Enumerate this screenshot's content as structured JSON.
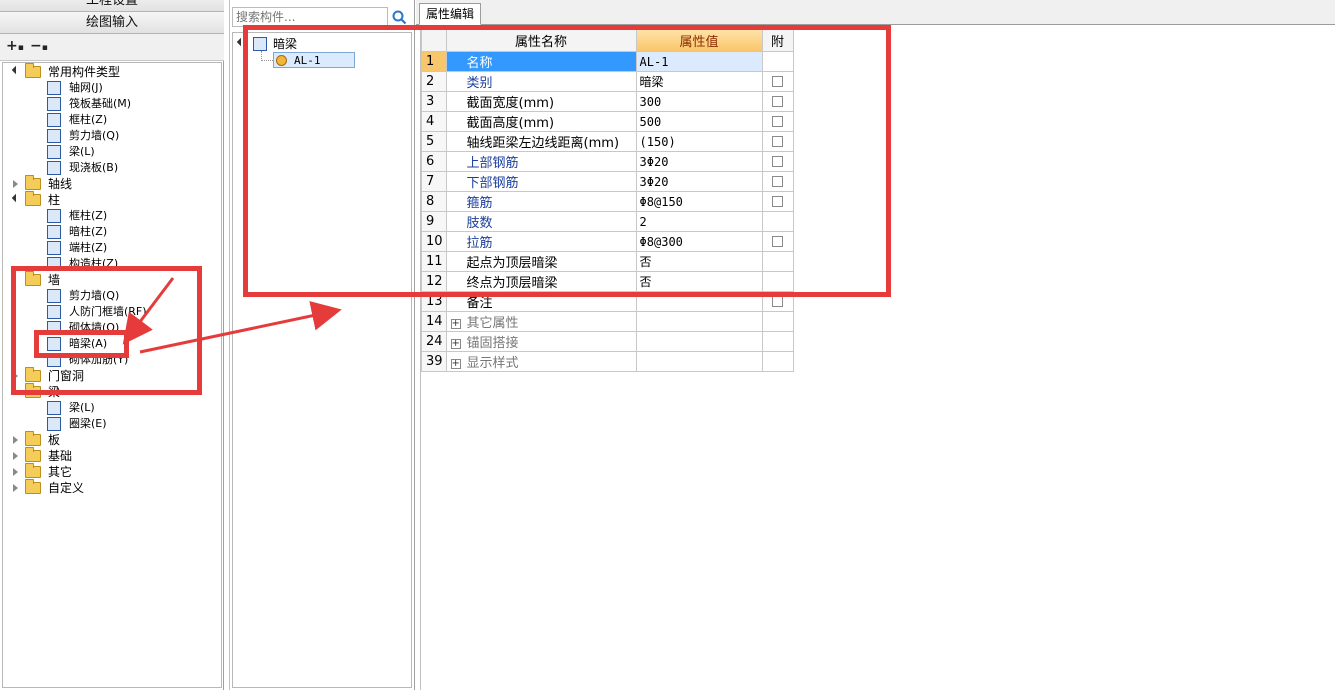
{
  "left_panel": {
    "header_project": "工程设置",
    "header_drawing": "绘图输入",
    "tree": [
      {
        "label": "常用构件类型",
        "type": "folder",
        "level": 0,
        "expanded": true
      },
      {
        "label": "轴网(J)",
        "type": "item",
        "level": 1,
        "icon": "grid-icon"
      },
      {
        "label": "筏板基础(M)",
        "type": "item",
        "level": 1,
        "icon": "raft-icon"
      },
      {
        "label": "框柱(Z)",
        "type": "item",
        "level": 1,
        "icon": "column-icon"
      },
      {
        "label": "剪力墙(Q)",
        "type": "item",
        "level": 1,
        "icon": "wall-icon"
      },
      {
        "label": "梁(L)",
        "type": "item",
        "level": 1,
        "icon": "beam-icon"
      },
      {
        "label": "现浇板(B)",
        "type": "item",
        "level": 1,
        "icon": "slab-icon"
      },
      {
        "label": "轴线",
        "type": "folder",
        "level": 0,
        "expanded": false
      },
      {
        "label": "柱",
        "type": "folder",
        "level": 0,
        "expanded": true
      },
      {
        "label": "框柱(Z)",
        "type": "item",
        "level": 1,
        "icon": "column-icon"
      },
      {
        "label": "暗柱(Z)",
        "type": "item",
        "level": 1,
        "icon": "column-icon"
      },
      {
        "label": "端柱(Z)",
        "type": "item",
        "level": 1,
        "icon": "column-icon"
      },
      {
        "label": "构造柱(Z)",
        "type": "item",
        "level": 1,
        "icon": "column-icon"
      },
      {
        "label": "墙",
        "type": "folder",
        "level": 0,
        "expanded": true
      },
      {
        "label": "剪力墙(Q)",
        "type": "item",
        "level": 1,
        "icon": "wall-icon"
      },
      {
        "label": "人防门框墙(RF)",
        "type": "item",
        "level": 1,
        "icon": "door-frame-icon"
      },
      {
        "label": "砌体墙(Q)",
        "type": "item",
        "level": 1,
        "icon": "masonry-icon"
      },
      {
        "label": "暗梁(A)",
        "type": "item",
        "level": 1,
        "icon": "hidden-beam-icon",
        "selected": true
      },
      {
        "label": "砌体加筋(Y)",
        "type": "item",
        "level": 1,
        "icon": "rebar-icon"
      },
      {
        "label": "门窗洞",
        "type": "folder",
        "level": 0,
        "expanded": false
      },
      {
        "label": "梁",
        "type": "folder",
        "level": 0,
        "expanded": true
      },
      {
        "label": "梁(L)",
        "type": "item",
        "level": 1,
        "icon": "beam-icon"
      },
      {
        "label": "圈梁(E)",
        "type": "item",
        "level": 1,
        "icon": "ring-beam-icon"
      },
      {
        "label": "板",
        "type": "folder",
        "level": 0,
        "expanded": false
      },
      {
        "label": "基础",
        "type": "folder",
        "level": 0,
        "expanded": false
      },
      {
        "label": "其它",
        "type": "folder",
        "level": 0,
        "expanded": false
      },
      {
        "label": "自定义",
        "type": "folder",
        "level": 0,
        "expanded": false
      }
    ]
  },
  "middle_panel": {
    "search_placeholder": "搜索构件...",
    "tree_root": "暗梁",
    "tree_child": "AL-1"
  },
  "right_panel": {
    "tab_label": "属性编辑",
    "columns": {
      "name": "属性名称",
      "value": "属性值",
      "attach": "附"
    },
    "rows": [
      {
        "num": "1",
        "name": "名称",
        "value": "AL-1",
        "color": "blue",
        "check": false,
        "selected": true
      },
      {
        "num": "2",
        "name": "类别",
        "value": "暗梁",
        "color": "blue",
        "check": true
      },
      {
        "num": "3",
        "name": "截面宽度(mm)",
        "value": "300",
        "color": "black",
        "check": true
      },
      {
        "num": "4",
        "name": "截面高度(mm)",
        "value": "500",
        "color": "black",
        "check": true
      },
      {
        "num": "5",
        "name": "轴线距梁左边线距离(mm)",
        "value": "(150)",
        "color": "black",
        "check": true
      },
      {
        "num": "6",
        "name": "上部钢筋",
        "value": "3Φ20",
        "color": "blue",
        "check": true
      },
      {
        "num": "7",
        "name": "下部钢筋",
        "value": "3Φ20",
        "color": "blue",
        "check": true
      },
      {
        "num": "8",
        "name": "箍筋",
        "value": "Φ8@150",
        "color": "blue",
        "check": true
      },
      {
        "num": "9",
        "name": "肢数",
        "value": "2",
        "color": "blue",
        "check": false
      },
      {
        "num": "10",
        "name": "拉筋",
        "value": "Φ8@300",
        "color": "blue",
        "check": true
      },
      {
        "num": "11",
        "name": "起点为顶层暗梁",
        "value": "否",
        "color": "black",
        "check": false
      },
      {
        "num": "12",
        "name": "终点为顶层暗梁",
        "value": "否",
        "color": "black",
        "check": false
      },
      {
        "num": "13",
        "name": "备注",
        "value": "",
        "color": "black",
        "check": true
      },
      {
        "num": "14",
        "name": "其它属性",
        "value": "",
        "color": "grey",
        "group": true,
        "check": false
      },
      {
        "num": "24",
        "name": "锚固搭接",
        "value": "",
        "color": "grey",
        "group": true,
        "check": false
      },
      {
        "num": "39",
        "name": "显示样式",
        "value": "",
        "color": "grey",
        "group": true,
        "check": false
      }
    ]
  },
  "colors": {
    "annotation_red": "#e53b3b",
    "selection_blue": "#3399ff",
    "header_orange": "#f9c56a",
    "label_blue": "#1c3f9e"
  }
}
